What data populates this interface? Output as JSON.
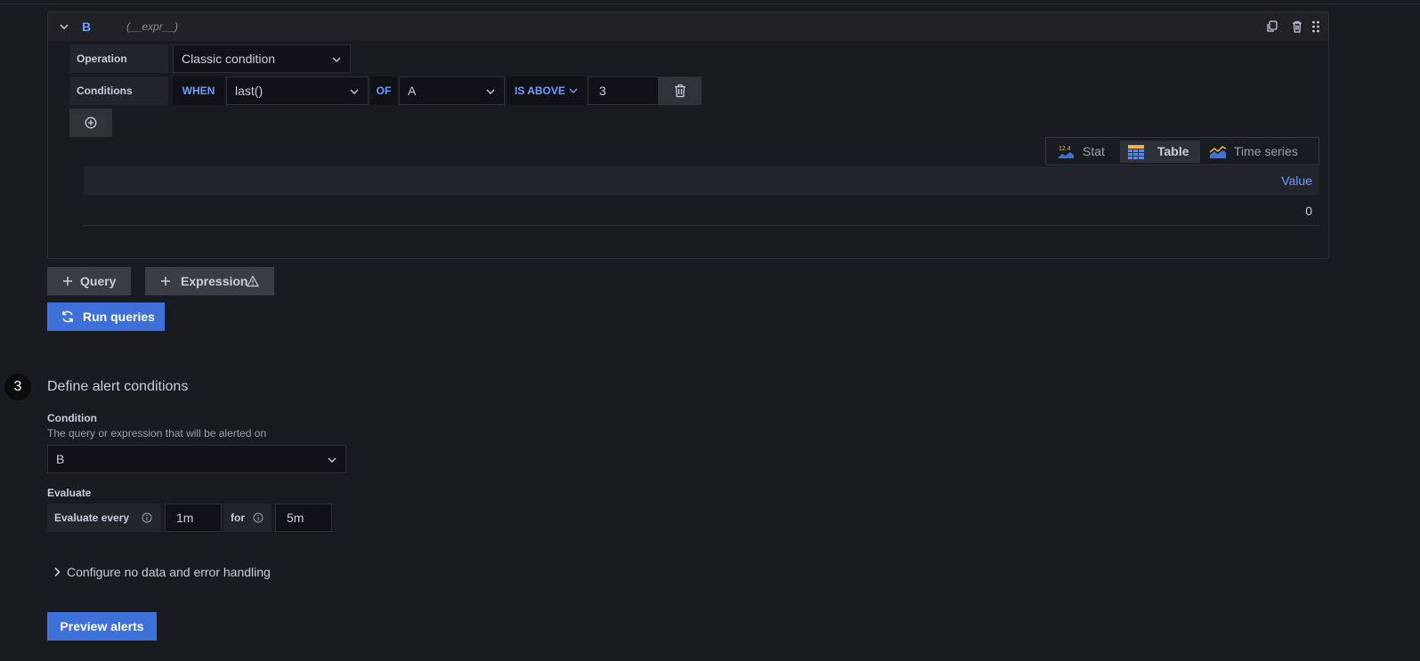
{
  "query": {
    "name": "B",
    "type_label": "(__expr__)",
    "operation_label": "Operation",
    "operation_value": "Classic condition",
    "conditions_label": "Conditions",
    "when_keyword": "WHEN",
    "reducer": "last()",
    "of_keyword": "OF",
    "query_ref": "A",
    "evaluator": "IS ABOVE",
    "threshold": "3"
  },
  "view_tabs": [
    {
      "label": "Stat",
      "icon": "stat-icon"
    },
    {
      "label": "Table",
      "icon": "table-icon",
      "active": true
    },
    {
      "label": "Time series",
      "icon": "time-series-icon"
    }
  ],
  "table": {
    "header": "Value",
    "rows": [
      "0"
    ]
  },
  "buttons": {
    "add_query": "Query",
    "add_expression": "Expression",
    "run_queries": "Run queries",
    "preview_alerts": "Preview alerts"
  },
  "section": {
    "number": "3",
    "title": "Define alert conditions",
    "condition_label": "Condition",
    "condition_desc": "The query or expression that will be alerted on",
    "condition_value": "B",
    "evaluate_label": "Evaluate",
    "evaluate_every_label": "Evaluate every",
    "evaluate_every_value": "1m",
    "for_label": "for",
    "for_value": "5m",
    "configure_label": "Configure no data and error handling"
  },
  "colors": {
    "accent_blue": "#3d71d9",
    "link_blue": "#6e9fff",
    "background": "#181b1f"
  }
}
